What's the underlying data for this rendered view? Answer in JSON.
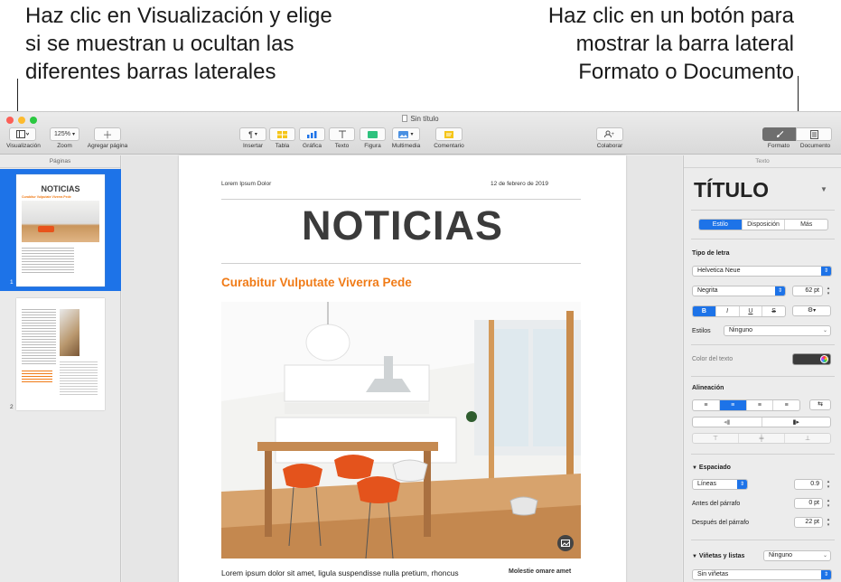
{
  "callouts": {
    "left": [
      "Haz clic en Visualización y elige",
      "si se muestran u ocultan las",
      "diferentes barras laterales"
    ],
    "right": [
      "Haz clic en un botón para",
      "mostrar la barra lateral",
      "Formato o Documento"
    ]
  },
  "window": {
    "title": "Sin título"
  },
  "toolbar": {
    "view_label": "Visualización",
    "zoom_value": "125%",
    "zoom_label": "Zoom",
    "add_page_label": "Agregar página",
    "insert_label": "Insertar",
    "table_label": "Tabla",
    "chart_label": "Gráfica",
    "text_label": "Texto",
    "shape_label": "Figura",
    "media_label": "Multimedia",
    "comment_label": "Comentario",
    "collaborate_label": "Colaborar",
    "format_label": "Formato",
    "document_label": "Documento"
  },
  "pages_sidebar": {
    "title": "Páginas",
    "page1_number": "1",
    "page2_number": "2",
    "thumb_title": "NOTICIAS",
    "thumb_subtitle": "Curabitur Vulputate Viverra Pede"
  },
  "document": {
    "header_left": "Lorem Ipsum Dolor",
    "header_right": "12 de febrero de 2019",
    "headline": "NOTICIAS",
    "subheadline": "Curabitur Vulputate Viverra Pede",
    "body_start": "Lorem ipsum dolor sit amet, ligula suspendisse nulla pretium, rhoncus",
    "side_caption": "Molestie omare amet"
  },
  "inspector": {
    "header": "Texto",
    "style_name": "TÍTULO",
    "tabs": [
      "Estilo",
      "Disposición",
      "Más"
    ],
    "font_section": "Tipo de letra",
    "font_family": "Helvetica Neue",
    "font_weight": "Negrita",
    "font_size": "62 pt",
    "format_buttons": [
      "B",
      "I",
      "U",
      "S"
    ],
    "styles_label": "Estilos",
    "styles_value": "Ninguno",
    "text_color_label": "Color del texto",
    "alignment_label": "Alineación",
    "spacing_label": "Espaciado",
    "spacing_mode": "Líneas",
    "spacing_value": "0.9",
    "before_label": "Antes del párrafo",
    "before_value": "0 pt",
    "after_label": "Después del párrafo",
    "after_value": "22 pt",
    "bullets_label": "Viñetas y listas",
    "bullets_value": "Ninguno",
    "bullets_style": "Sin viñetas"
  },
  "colors": {
    "accent": "#1d73e8",
    "orange": "#f07b17",
    "headline": "#3b3b3b"
  }
}
